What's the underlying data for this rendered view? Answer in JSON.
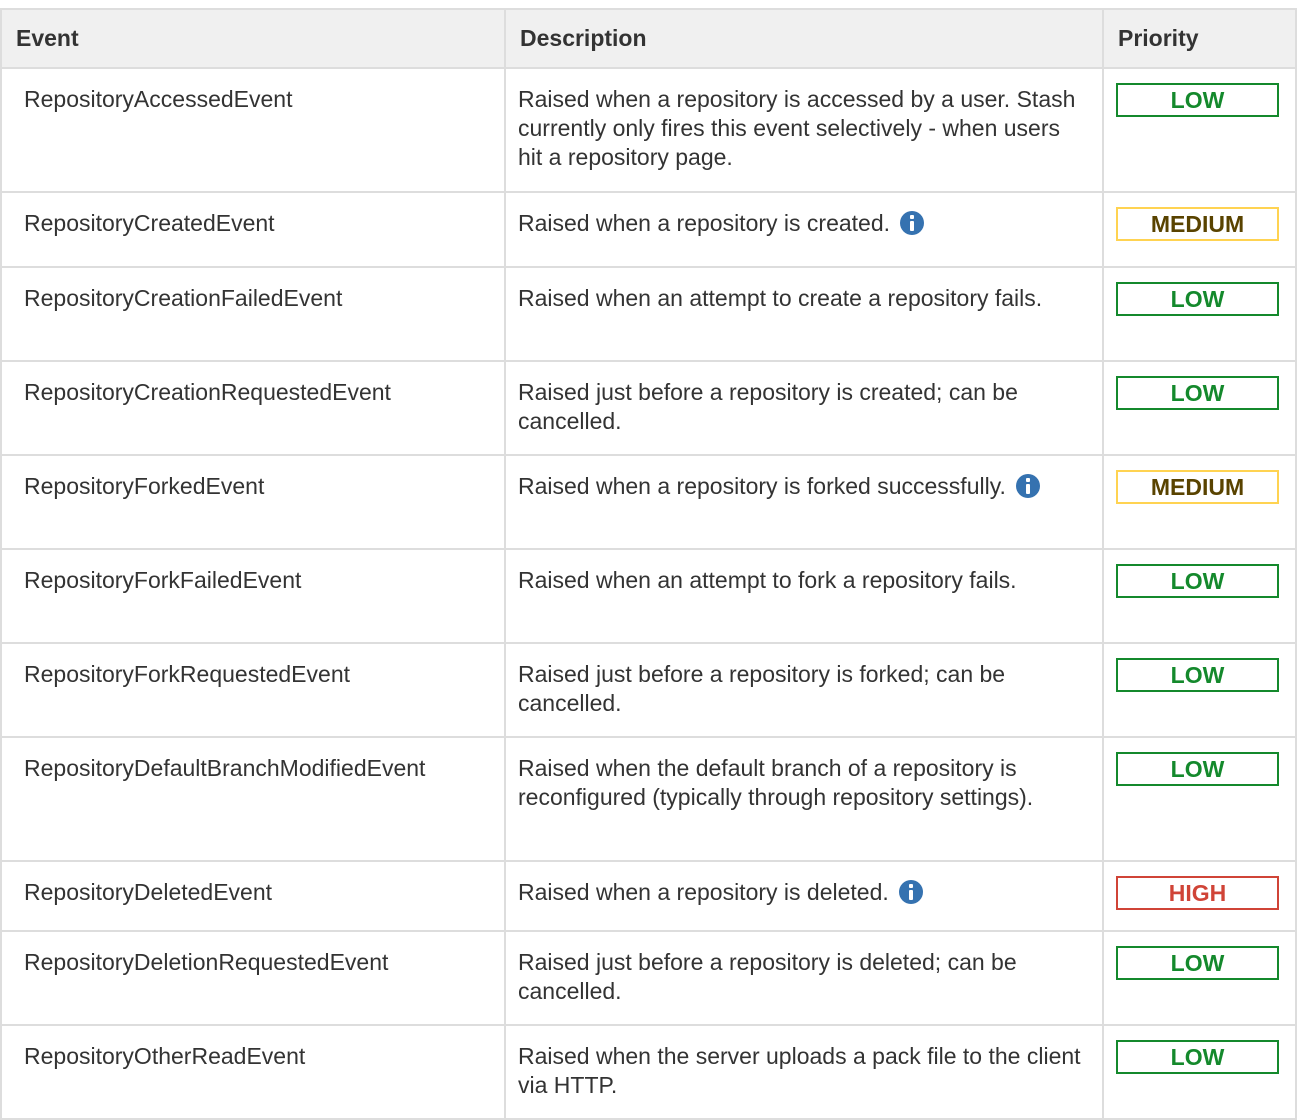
{
  "table": {
    "headers": {
      "event": "Event",
      "description": "Description",
      "priority": "Priority"
    },
    "rows": [
      {
        "event": "RepositoryAccessedEvent",
        "description": "Raised when a repository is accessed by a user. Stash currently only fires this event selectively - when users hit a repository page.",
        "priority": "LOW",
        "info_icon": false
      },
      {
        "event": "RepositoryCreatedEvent",
        "description": "Raised when a repository is created.",
        "priority": "MEDIUM",
        "info_icon": true
      },
      {
        "event": "RepositoryCreationFailedEvent",
        "description": "Raised when an attempt to create a repository fails.",
        "priority": "LOW",
        "info_icon": false
      },
      {
        "event": "RepositoryCreationRequestedEvent",
        "description": "Raised just before a repository is created; can be cancelled.",
        "priority": "LOW",
        "info_icon": false
      },
      {
        "event": "RepositoryForkedEvent",
        "description": "Raised when a repository is forked successfully.",
        "priority": "MEDIUM",
        "info_icon": true
      },
      {
        "event": "RepositoryForkFailedEvent",
        "description": "Raised when an attempt to fork a repository fails.",
        "priority": "LOW",
        "info_icon": false
      },
      {
        "event": "RepositoryForkRequestedEvent",
        "description": "Raised just before a repository is forked; can be cancelled.",
        "priority": "LOW",
        "info_icon": false
      },
      {
        "event": "RepositoryDefaultBranchModifiedEvent",
        "description": "Raised when the default branch of a repository is reconfigured (typically through repository settings).",
        "priority": "LOW",
        "info_icon": false
      },
      {
        "event": "RepositoryDeletedEvent",
        "description": "Raised when a repository is deleted.",
        "priority": "HIGH",
        "info_icon": true
      },
      {
        "event": "RepositoryDeletionRequestedEvent",
        "description": "Raised just before a repository is deleted; can be cancelled.",
        "priority": "LOW",
        "info_icon": false
      },
      {
        "event": "RepositoryOtherReadEvent",
        "description": "Raised when the server uploads a pack file to the client via HTTP.",
        "priority": "LOW",
        "info_icon": false
      }
    ]
  },
  "colors": {
    "low": "#14892c",
    "medium_border": "#ffd351",
    "medium_text": "#594300",
    "high": "#d04437",
    "info_icon": "#3572b0",
    "header_bg": "#f0f0f0",
    "border": "#dddddd"
  },
  "icons": {
    "info": "info-icon"
  }
}
